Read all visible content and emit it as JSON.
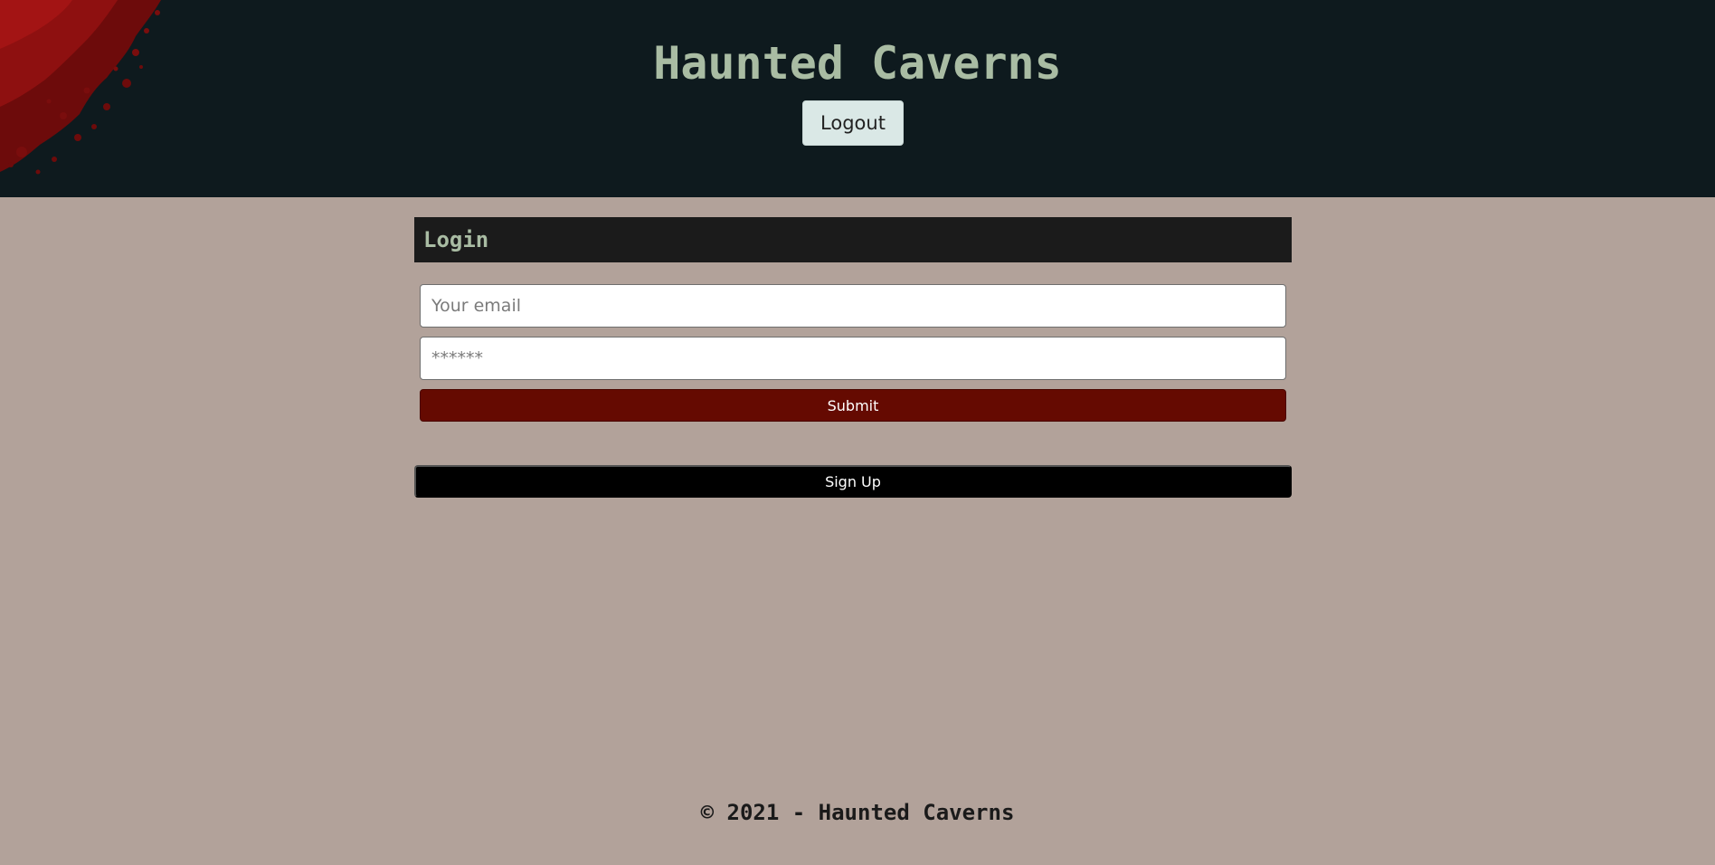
{
  "header": {
    "title": "Haunted Caverns",
    "logout_label": "Logout",
    "background_color": "#0e1a1e",
    "title_color": "#a9bca3",
    "decoration_icon": "blood-splatter-icon"
  },
  "login": {
    "heading": "Login",
    "email_placeholder": "Your email",
    "email_value": "",
    "password_placeholder": "******",
    "password_value": "",
    "submit_label": "Submit",
    "submit_color": "#650a01"
  },
  "signup": {
    "label": "Sign Up",
    "color": "#000000"
  },
  "footer": {
    "text": "© 2021 - Haunted Caverns"
  },
  "page": {
    "background_color": "#b2a29a"
  }
}
